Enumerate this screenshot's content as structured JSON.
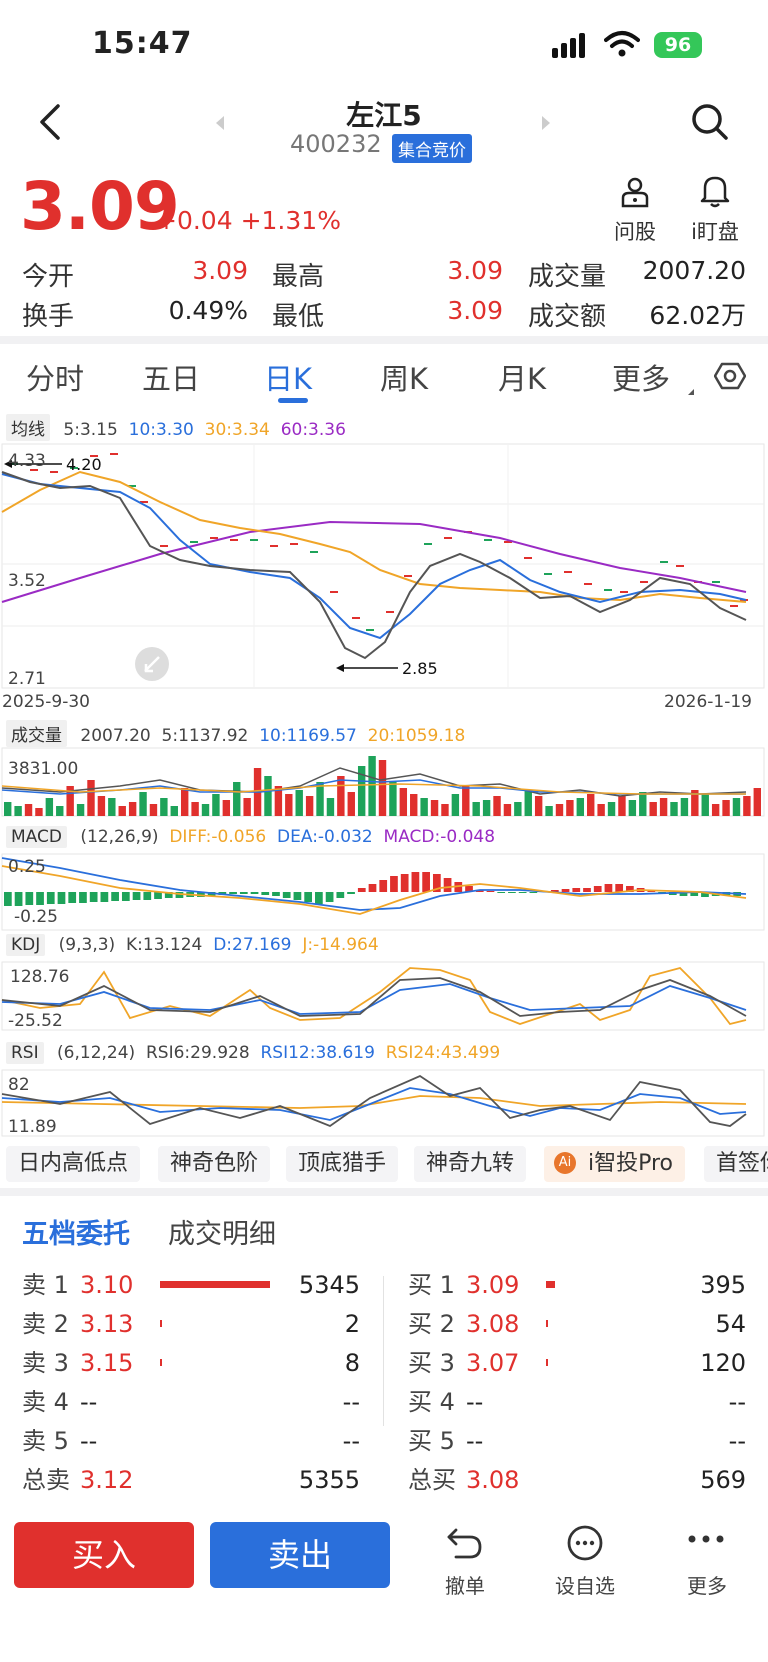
{
  "status_bar": {
    "time": "15:47",
    "battery": "96"
  },
  "header": {
    "title": "左江5",
    "code": "400232",
    "tag": "集合竞价"
  },
  "quote": {
    "price": "3.09",
    "change": "+0.04",
    "change_pct": "+1.31%",
    "ask_label": "问股",
    "watch_label": "i盯盘",
    "stats": [
      {
        "label": "今开",
        "value": "3.09"
      },
      {
        "label": "最高",
        "value": "3.09"
      },
      {
        "label": "成交量",
        "value": "2007.20"
      },
      {
        "label": "换手",
        "value": "0.49%"
      },
      {
        "label": "最低",
        "value": "3.09"
      },
      {
        "label": "成交额",
        "value": "62.02万"
      }
    ]
  },
  "tabs": [
    "分时",
    "五日",
    "日K",
    "周K",
    "月K",
    "更多"
  ],
  "active_tab": "日K",
  "ma_bar": {
    "tag": "均线",
    "ma5": "5:3.15",
    "ma10": "10:3.30",
    "ma30": "30:3.34",
    "ma60": "60:3.36"
  },
  "kline": {
    "y_top": "4.33",
    "y_mid": "3.52",
    "y_bot": "2.71",
    "high_mark": "4.20",
    "low_mark": "2.85",
    "date_start": "2025-9-30",
    "date_end": "2026-1-19"
  },
  "volume_bar": {
    "tag": "成交量",
    "value": "2007.20",
    "ma5": "5:1137.92",
    "ma10": "10:1169.57",
    "ma20": "20:1059.18",
    "y_max": "3831.00"
  },
  "macd_bar": {
    "tag": "MACD",
    "params": "(12,26,9)",
    "diff": "DIFF:-0.056",
    "dea": "DEA:-0.032",
    "macd": "MACD:-0.048",
    "y_top": "0.25",
    "y_bot": "-0.25"
  },
  "kdj_bar": {
    "tag": "KDJ",
    "params": "(9,3,3)",
    "k": "K:13.124",
    "d": "D:27.169",
    "j": "J:-14.964",
    "y_top": "128.76",
    "y_bot": "-25.52"
  },
  "rsi_bar": {
    "tag": "RSI",
    "params": "(6,12,24)",
    "rsi6": "RSI6:29.928",
    "rsi12": "RSI12:38.619",
    "rsi24": "RSI24:43.499",
    "y_top": "82",
    "y_bot": "11.89"
  },
  "chips": [
    "日内高低点",
    "神奇色阶",
    "顶底猎手",
    "神奇九转",
    "i智投Pro",
    "首签你"
  ],
  "orderbook": {
    "tabs": [
      "五档委托",
      "成交明细"
    ],
    "sells": [
      {
        "label": "卖 1",
        "price": "3.10",
        "vol": "5345",
        "bar": 1.0
      },
      {
        "label": "卖 2",
        "price": "3.13",
        "vol": "2",
        "bar": 0.02
      },
      {
        "label": "卖 3",
        "price": "3.15",
        "vol": "8",
        "bar": 0.02
      },
      {
        "label": "卖 4",
        "price": "--",
        "vol": "--",
        "bar": 0
      },
      {
        "label": "卖 5",
        "price": "--",
        "vol": "--",
        "bar": 0
      },
      {
        "label": "总卖",
        "price": "3.12",
        "vol": "5355",
        "bar": 0
      }
    ],
    "buys": [
      {
        "label": "买 1",
        "price": "3.09",
        "vol": "395",
        "bar": 0.08
      },
      {
        "label": "买 2",
        "price": "3.08",
        "vol": "54",
        "bar": 0.02
      },
      {
        "label": "买 3",
        "price": "3.07",
        "vol": "120",
        "bar": 0.02
      },
      {
        "label": "买 4",
        "price": "--",
        "vol": "--",
        "bar": 0
      },
      {
        "label": "买 5",
        "price": "--",
        "vol": "--",
        "bar": 0
      },
      {
        "label": "总买",
        "price": "3.08",
        "vol": "569",
        "bar": 0
      }
    ]
  },
  "actions": {
    "buy": "买入",
    "sell": "卖出",
    "cancel": "撤单",
    "watchlist": "设自选",
    "more": "更多"
  },
  "colors": {
    "up": "#e0302d",
    "down": "#1ea35a",
    "accent": "#2a6fdb",
    "ma10": "#2a6fdb",
    "ma30": "#f0a528",
    "ma60": "#9a2bc4"
  }
}
